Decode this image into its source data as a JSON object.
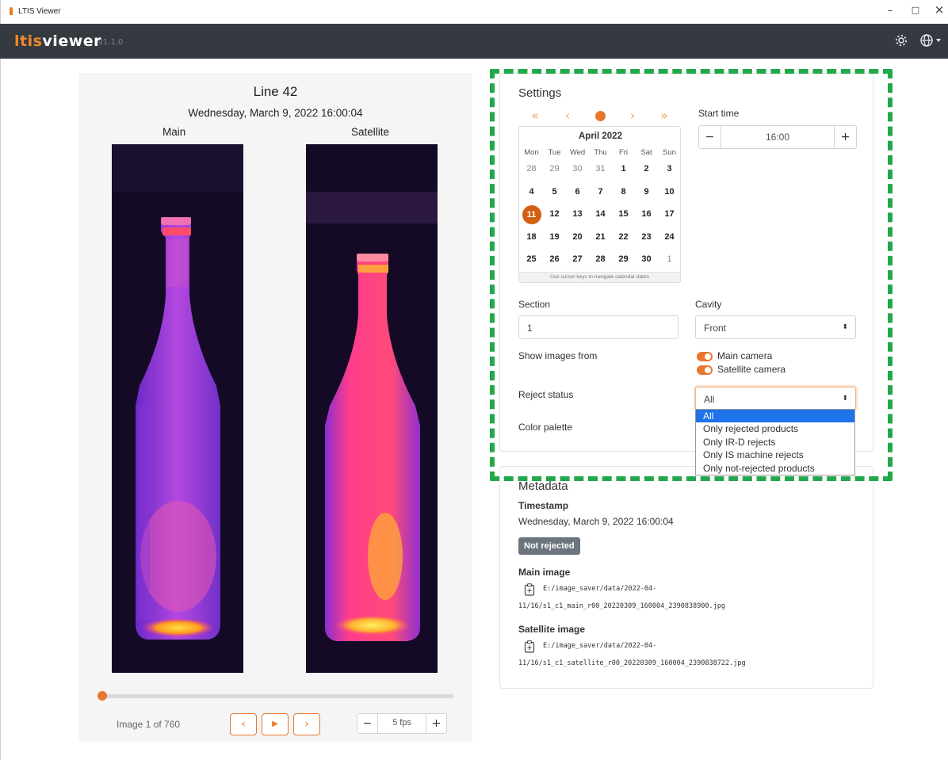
{
  "window": {
    "title": "LTIS Viewer",
    "minimize": "–",
    "maximize": "□",
    "close": "×"
  },
  "app": {
    "brand_part1": "ltis",
    "brand_part2": "viewer",
    "version": "v1.1.0",
    "settings_icon": "gear-icon",
    "language_icon": "globe-icon"
  },
  "viewer": {
    "line_title": "Line 42",
    "datetime": "Wednesday, March 9, 2022 16:00:04",
    "main_label": "Main",
    "satellite_label": "Satellite",
    "image_counter": "Image 1 of 760",
    "playback_progress": 0.0,
    "prev_label": "‹",
    "play_label": "▶",
    "next_label": "›",
    "fps_minus": "−",
    "fps_value": "5 fps",
    "fps_plus": "+"
  },
  "settings": {
    "title": "Settings",
    "calendar": {
      "nav": {
        "prev_year": "«",
        "prev_month": "‹",
        "next_month": "›",
        "next_year": "»"
      },
      "month": "April 2022",
      "weekdays": [
        "Mon",
        "Tue",
        "Wed",
        "Thu",
        "Fri",
        "Sat",
        "Sun"
      ],
      "weeks": [
        [
          "28",
          "29",
          "30",
          "31",
          "1",
          "2",
          "3"
        ],
        [
          "4",
          "5",
          "6",
          "7",
          "8",
          "9",
          "10"
        ],
        [
          "11",
          "12",
          "13",
          "14",
          "15",
          "16",
          "17"
        ],
        [
          "18",
          "19",
          "20",
          "21",
          "22",
          "23",
          "24"
        ],
        [
          "25",
          "26",
          "27",
          "28",
          "29",
          "30",
          "1"
        ]
      ],
      "selected": "11",
      "footer": "Use cursor keys to navigate calendar dates"
    },
    "start_time_label": "Start time",
    "start_time_minus": "−",
    "start_time_value": "16:00",
    "start_time_plus": "+",
    "section_label": "Section",
    "section_value": "1",
    "cavity_label": "Cavity",
    "cavity_value": "Front",
    "show_images_label": "Show images from",
    "main_camera_label": "Main camera",
    "main_camera_on": true,
    "satellite_camera_label": "Satellite camera",
    "satellite_camera_on": true,
    "reject_status_label": "Reject status",
    "reject_status_value": "All",
    "reject_options": [
      "All",
      "Only rejected products",
      "Only IR-D rejects",
      "Only IS machine rejects",
      "Only not-rejected products"
    ],
    "color_palette_label": "Color palette"
  },
  "metadata": {
    "title": "Metadata",
    "timestamp_label": "Timestamp",
    "timestamp_value": "Wednesday, March 9, 2022 16:00:04",
    "reject_badge": "Not rejected",
    "main_image_label": "Main image",
    "main_image_path_1": "E:/image_saver/data/2022-04-",
    "main_image_path_2": "11/16/s1_c1_main_r00_20220309_160004_2390838900.jpg",
    "satellite_image_label": "Satellite image",
    "satellite_image_path_1": "E:/image_saver/data/2022-04-",
    "satellite_image_path_2": "11/16/s1_c1_satellite_r00_20220309_160004_2390838722.jpg"
  },
  "colors": {
    "accent": "#e8772e",
    "navbar": "#343a40",
    "selection": "#1e73e8",
    "highlight_dash": "#22a84a",
    "badge": "#6c757d"
  }
}
